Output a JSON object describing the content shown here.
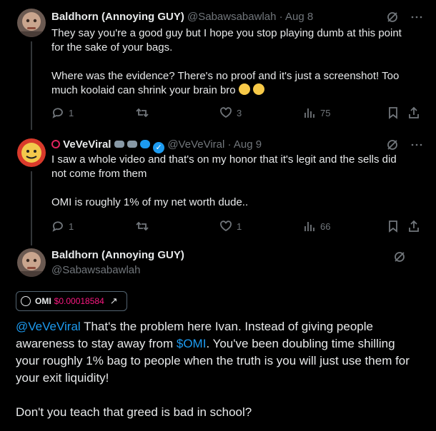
{
  "tweet1": {
    "name": "Baldhorn (Annoying GUY)",
    "handle": "@Sabawsabawlah",
    "dot": "·",
    "date": "Aug 8",
    "line1": "They say you're a good guy but I hope you stop playing dumb at this point",
    "line2": "for the sake of your bags.",
    "line3": "Where was the evidence? There's no proof and it's just a screenshot! Too",
    "line4": "much koolaid can shrink your brain bro",
    "replies": "1",
    "likes": "3",
    "views": "75"
  },
  "tweet2": {
    "name": "VeVeViral",
    "handle": "@VeVeViral",
    "dot": "·",
    "date": "Aug 9",
    "line1": "I saw a whole video and that's on my honor that it's legit and the sells did",
    "line2": "not come from them",
    "line3": "OMI is roughly 1% of my net worth dude..",
    "replies": "1",
    "likes": "1",
    "views": "66"
  },
  "main": {
    "name": "Baldhorn (Annoying GUY)",
    "handle": "@Sabawsabawlah",
    "chip_symbol": "OMI",
    "chip_price": "$0.00018584",
    "mention": "@VeVeViral",
    "text_a": " That's the problem here Ivan. Instead of giving people",
    "text_b": "awareness to stay away from ",
    "cashtag": "$OMI",
    "text_c": ". You've been doubling time shilling",
    "text_d": "your roughly 1% bag to people when the truth is you will just use them for",
    "text_e": "your exit liquidity!",
    "text_f": "Don't you teach that greed is bad in school?"
  },
  "colors": {
    "background": "#000000",
    "text": "#e7e9ea",
    "muted": "#71767b",
    "link": "#1d9bf0",
    "price": "#f91880"
  }
}
